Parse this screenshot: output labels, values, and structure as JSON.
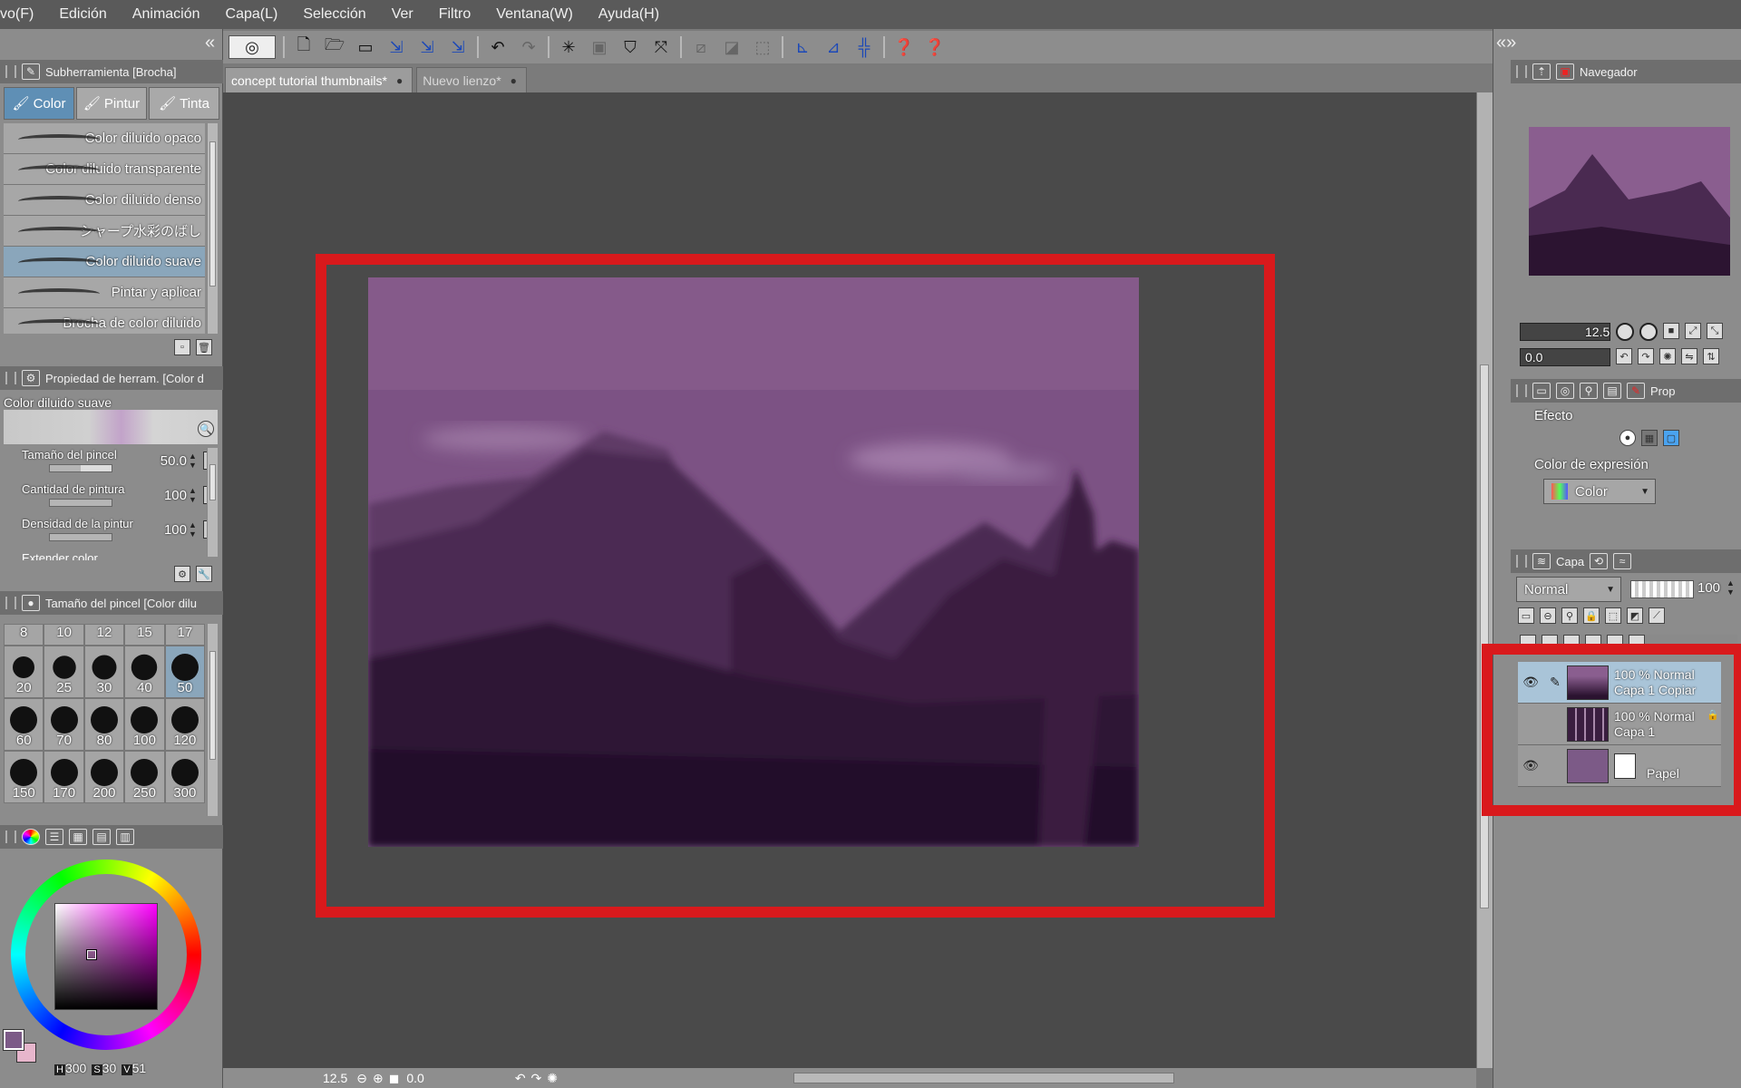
{
  "menu": [
    "vo(F)",
    "Edición",
    "Animación",
    "Capa(L)",
    "Selección",
    "Ver",
    "Filtro",
    "Ventana(W)",
    "Ayuda(H)"
  ],
  "subtool_panel": {
    "title": "Subherramienta [Brocha]",
    "tabs": [
      "Color",
      "Pintur",
      "Tinta"
    ],
    "brushes": [
      "Color diluido opaco",
      "Color diluido transparente",
      "Color diluido denso",
      "シャープ水彩のばし",
      "Color diluido suave",
      "Pintar y aplicar",
      "Brocha de color diluido"
    ],
    "selected_brush": "Color diluido suave"
  },
  "property_panel": {
    "title": "Propiedad de herram. [Color d",
    "tool_name": "Color diluido suave",
    "rows": [
      {
        "label": "Tamaño del pincel",
        "value": "50.0",
        "fill": 0.5
      },
      {
        "label": "Cantidad de pintura",
        "value": "100",
        "fill": 1.0
      },
      {
        "label": "Densidad de la pintur",
        "value": "100",
        "fill": 1.0
      },
      {
        "label": "Extender color",
        "value": "",
        "fill": 0
      }
    ]
  },
  "brush_size_panel": {
    "title": "Tamaño del pincel [Color dilu",
    "header": [
      "8",
      "10",
      "12",
      "15",
      "17"
    ],
    "rows": [
      [
        "20",
        "25",
        "30",
        "40",
        "50"
      ],
      [
        "60",
        "70",
        "80",
        "100",
        "120"
      ],
      [
        "150",
        "170",
        "200",
        "250",
        "300"
      ]
    ],
    "selected": "50"
  },
  "color": {
    "fg": "#7c5a87",
    "bg": "#e7b6cc",
    "h_label": "H",
    "h": "300",
    "s_label": "S",
    "s": "30",
    "v_label": "V",
    "v": "51"
  },
  "document_tabs": [
    "concept tutorial thumbnails*",
    "Nuevo lienzo*"
  ],
  "status": {
    "zoom": "12.5",
    "angle": "0.0"
  },
  "navigator": {
    "title": "Navegador",
    "zoom": "12.5",
    "angle": "0.0"
  },
  "properties_panel": {
    "tab_label": "Prop",
    "effect_label": "Efecto",
    "expression_label": "Color de expresión",
    "expression_value": "Color"
  },
  "layer_panel": {
    "title": "Capa",
    "blend_mode": "Normal",
    "opacity": "100",
    "layers": [
      {
        "line1": "100 % Normal",
        "line2": "Capa 1 Copiar",
        "visible": true,
        "selected": true
      },
      {
        "line1": "100 % Normal",
        "line2": "Capa 1",
        "visible": false,
        "selected": false
      },
      {
        "line1": "",
        "line2": "Papel",
        "visible": true,
        "selected": false
      }
    ]
  },
  "annotation_color": "#d9191c"
}
